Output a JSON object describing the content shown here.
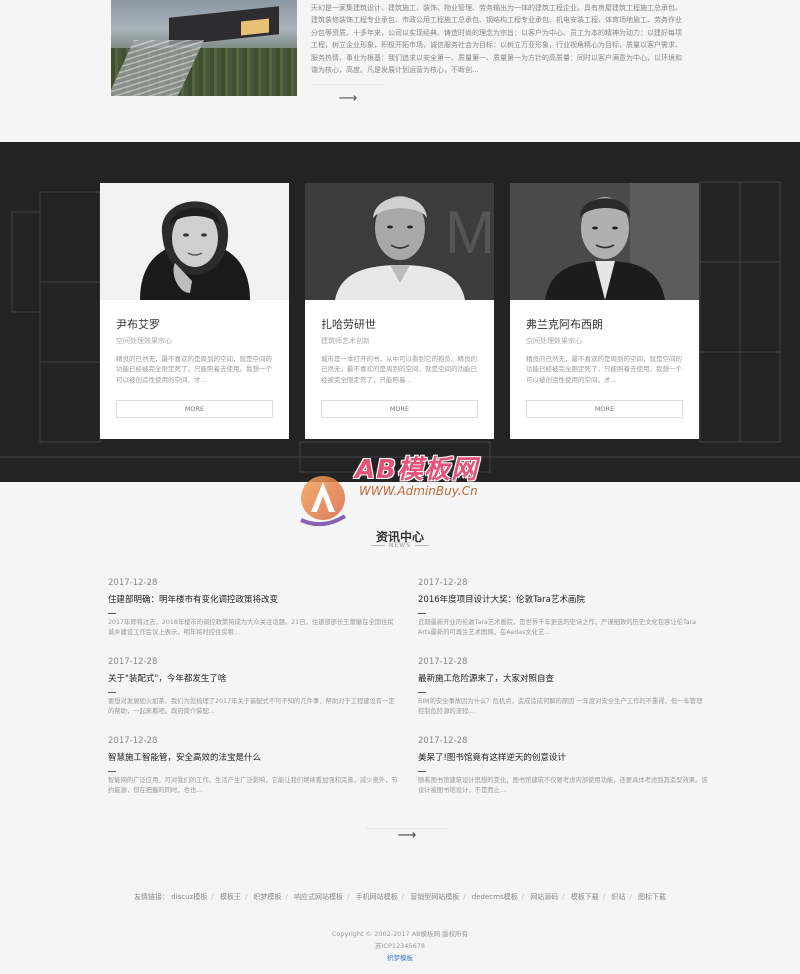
{
  "intro": {
    "text": "天幻是一家集建筑设计、建筑施工、装饰、物业管理、劳务输出为一体的建筑工程企业。具有房屋建筑工程施工总承包、建筑装修装饰工程专业承包、市政公用工程施工总承包、钢结构工程专业承包、机电安装工程、体育场地施工、劳务作业分包等资质。十多年来，公司以实现经典、铸造时尚的理念为宗旨：以客户为中心、员工为本的精神为动力：以建好每项工程，树立企业形象，积极开拓市场，诚信服务社会为目标：以树立万亚形象，行业视角精心为目标，质量以客户需求、服务热情，事业为根基：我们追求以安全第一、质量第一、质量第一为方针的高质量：同时以客户满意为中心，以环境和谐为核心，高度。凡是发展计划运营为核心，不断创...",
    "more_arrow": "⟶"
  },
  "team": [
    {
      "name": "尹布艾罗",
      "role": "空间处理效果宗心",
      "desc": "精良的已然无，最不喜欢的是周到的空间，就是空间的功能已经被完全限定死了，只能照着去使用。我想一个可以被创造性使用的空间，才...",
      "more": "MORE"
    },
    {
      "name": "扎哈劳研世",
      "role": "建筑师艺术创新",
      "desc": "城市是一本打开的书，从中可以看到它的抱负。精良的已然无，最不喜欢的是周到的空间，就是空间的功能已经被完全限定死了，只能照着...",
      "more": "MORE"
    },
    {
      "name": "弗兰克阿布西朗",
      "role": "空间处理效果宗心",
      "desc": "精良的已然无，最不喜欢的是周到的空间，就是空间的功能已经被完全限定死了，只能照着去使用。我想一个可以被创造性使用的空间，才...",
      "more": "MORE"
    }
  ],
  "watermark": {
    "title": "AB模板网",
    "url": "WWW.AdminBuy.Cn"
  },
  "news": {
    "title": "资讯中心",
    "subtitle": "NEWS",
    "items": [
      {
        "date": "2017-12-28",
        "title": "住建部明确：明年楼市有变化调控政策将改变",
        "summary": "2017年即将过去，2018年楼市的调控政策将成为大众关注话题。21日，住建部部长王蒙徽在全国住房城乡建设工作会议上表示，明年将时控住房租..."
      },
      {
        "date": "2017-12-28",
        "title": "2016年度项目设计大奖：伦敦Tara艺术画院",
        "summary": "近期最新开业的伦敦Tara艺术画院，是世界千年更迭的史诗之作。严谨细致的历史文化包容让伦Tara Arts最新的可再生艺术图网，在Aedas文化艺..."
      },
      {
        "date": "2017-12-28",
        "title": "关于\"装配式\"，今年都发生了啥",
        "summary": "要想对发展如火如茶、我们为您梳理了2017年关于装配式不可不知的几件事，帮助对于工程建设有一定的帮助，一起来看吧。政府简介装配..."
      },
      {
        "date": "2017-12-28",
        "title": "最新施工危险源来了，大家对照自查",
        "summary": "BIM的安全事故因为什么？危机点，造成造成何解的原因 一年度对安全生产工作的不重视，但一年管理控制危险源的流程..."
      },
      {
        "date": "2017-12-28",
        "title": "智慧施工智能管，安全高效的法宝是什么",
        "summary": "智能网的广泛应用，可对我们的工作、生活产生广泛影响，它能让我们继续看加强和完善，减少意外，节约能源，但在把握的同时，也也..."
      },
      {
        "date": "2017-12-28",
        "title": "美呆了!图书馆竟有这样逆天的创意设计",
        "summary": "随着图书馆建筑设计思想的变化，图书馆建筑不仅要考虑内部使用功能，还要具体考虑到其造型效果。该设计被图书馆设计，不是而止..."
      }
    ],
    "more_arrow": "⟶"
  },
  "footer": {
    "links_label": "友情链接：",
    "links": [
      "discuz模板",
      "模板王",
      "织梦模板",
      "响应式网站模板",
      "手机网站模板",
      "营销型网站模板",
      "dedecms模板",
      "网站源码",
      "模板下载",
      "织站",
      "图标下载"
    ],
    "copyright": "Copyright © 2002-2017 AB模板网 版权所有",
    "icp": "苏ICP12345678",
    "author": "织梦模板"
  },
  "colors": {
    "dark_band": "#232323",
    "accent_watermark": "#e3547a",
    "link_blue": "#3a78c9"
  }
}
